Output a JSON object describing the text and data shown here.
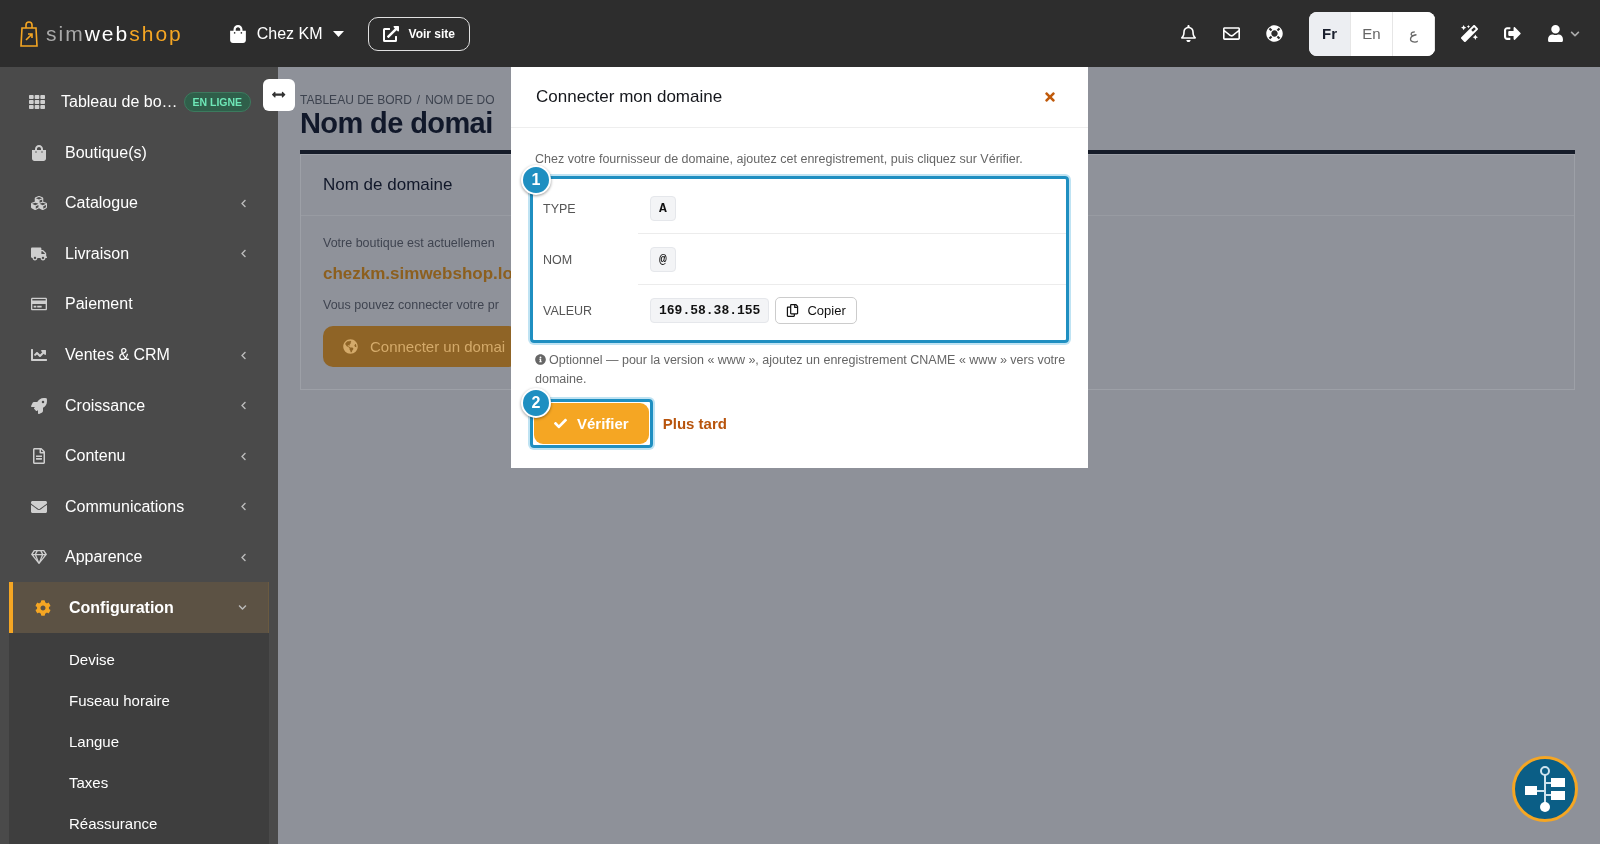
{
  "topbar": {
    "brand": [
      {
        "text": "sim",
        "kind": "muted"
      },
      {
        "text": "web",
        "kind": "bright"
      },
      {
        "text": "shop",
        "kind": "accent"
      }
    ],
    "shop": "Chez KM",
    "view_site": "Voir site",
    "languages": [
      {
        "label": "Fr",
        "selected": true
      },
      {
        "label": "En",
        "selected": false
      },
      {
        "label": "ع",
        "selected": false
      }
    ]
  },
  "sidebar": {
    "items": [
      {
        "label": "Tableau de bo…",
        "badge": "EN LIGNE",
        "selected": false
      },
      {
        "label": "Boutique(s)",
        "selected": false
      },
      {
        "label": "Catalogue",
        "expanded": false,
        "selected": false
      },
      {
        "label": "Livraison",
        "expanded": false,
        "selected": false
      },
      {
        "label": "Paiement",
        "selected": false
      },
      {
        "label": "Ventes & CRM",
        "expanded": false,
        "selected": false
      },
      {
        "label": "Croissance",
        "expanded": false,
        "selected": false
      },
      {
        "label": "Contenu",
        "expanded": false,
        "selected": false
      },
      {
        "label": "Communications",
        "expanded": false,
        "selected": false
      },
      {
        "label": "Apparence",
        "expanded": false,
        "selected": false
      },
      {
        "label": "Configuration",
        "expanded": true,
        "selected": true,
        "children": [
          {
            "label": "Devise"
          },
          {
            "label": "Fuseau horaire"
          },
          {
            "label": "Langue"
          },
          {
            "label": "Taxes"
          },
          {
            "label": "Réassurance"
          }
        ]
      }
    ]
  },
  "main": {
    "breadcrumb": [
      "TABLEAU DE BORD",
      "NOM DE DO"
    ],
    "breadcrumb_separator": "/",
    "title": "Nom de domai",
    "card": {
      "title": "Nom de domaine",
      "text": "Votre boutique est actuellemen",
      "domain": "chezkm.simwebshop.lo",
      "text_2": "Vous pouvez connecter votre pr",
      "button": "Connecter un domai"
    }
  },
  "modal": {
    "title": "Connecter mon domaine",
    "intro": "Chez votre fournisseur de domaine, ajoutez cet enregistrement, puis cliquez sur Vérifier.",
    "steps": [
      "1",
      "2"
    ],
    "records": [
      {
        "label": "TYPE",
        "value": "A"
      },
      {
        "label": "NOM",
        "value": "@"
      },
      {
        "label": "VALEUR",
        "value": "169.58.38.155",
        "copy": "Copier"
      }
    ],
    "note": "Optionnel — pour la version « www », ajoutez un enregistrement CNAME « www » vers votre domaine.",
    "verify": "Vérifier",
    "later": "Plus tard"
  }
}
